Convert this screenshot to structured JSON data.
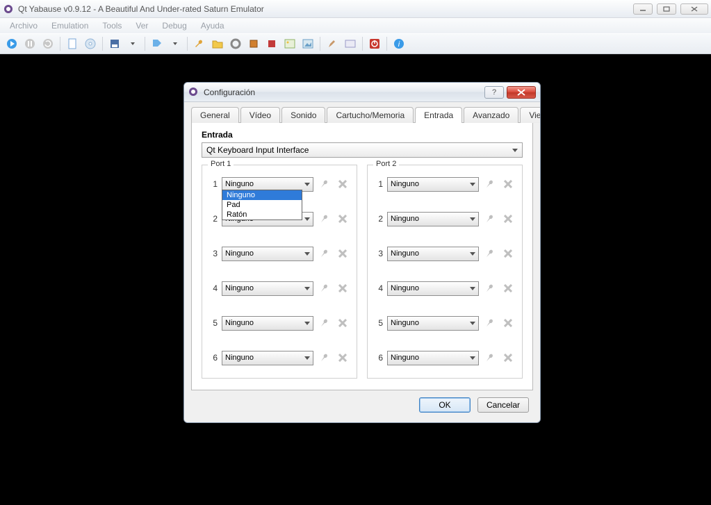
{
  "window": {
    "title": "Qt Yabause v0.9.12 - A Beautiful And Under-rated Saturn Emulator"
  },
  "menu": {
    "items": [
      "Archivo",
      "Emulation",
      "Tools",
      "Ver",
      "Debug",
      "Ayuda"
    ]
  },
  "dialog": {
    "title": "Configuración",
    "tabs": [
      "General",
      "Vídeo",
      "Sonido",
      "Cartucho/Memoria",
      "Entrada",
      "Avanzado",
      "View"
    ],
    "active_tab": "Entrada",
    "section_label": "Entrada",
    "interface_value": "Qt Keyboard Input Interface",
    "port1_label": "Port 1",
    "port2_label": "Port 2",
    "none_label": "Ninguno",
    "dropdown_options": [
      "Ninguno",
      "Pad",
      "Ratón"
    ],
    "ok_label": "OK",
    "cancel_label": "Cancelar"
  },
  "slots": [
    "1",
    "2",
    "3",
    "4",
    "5",
    "6"
  ]
}
